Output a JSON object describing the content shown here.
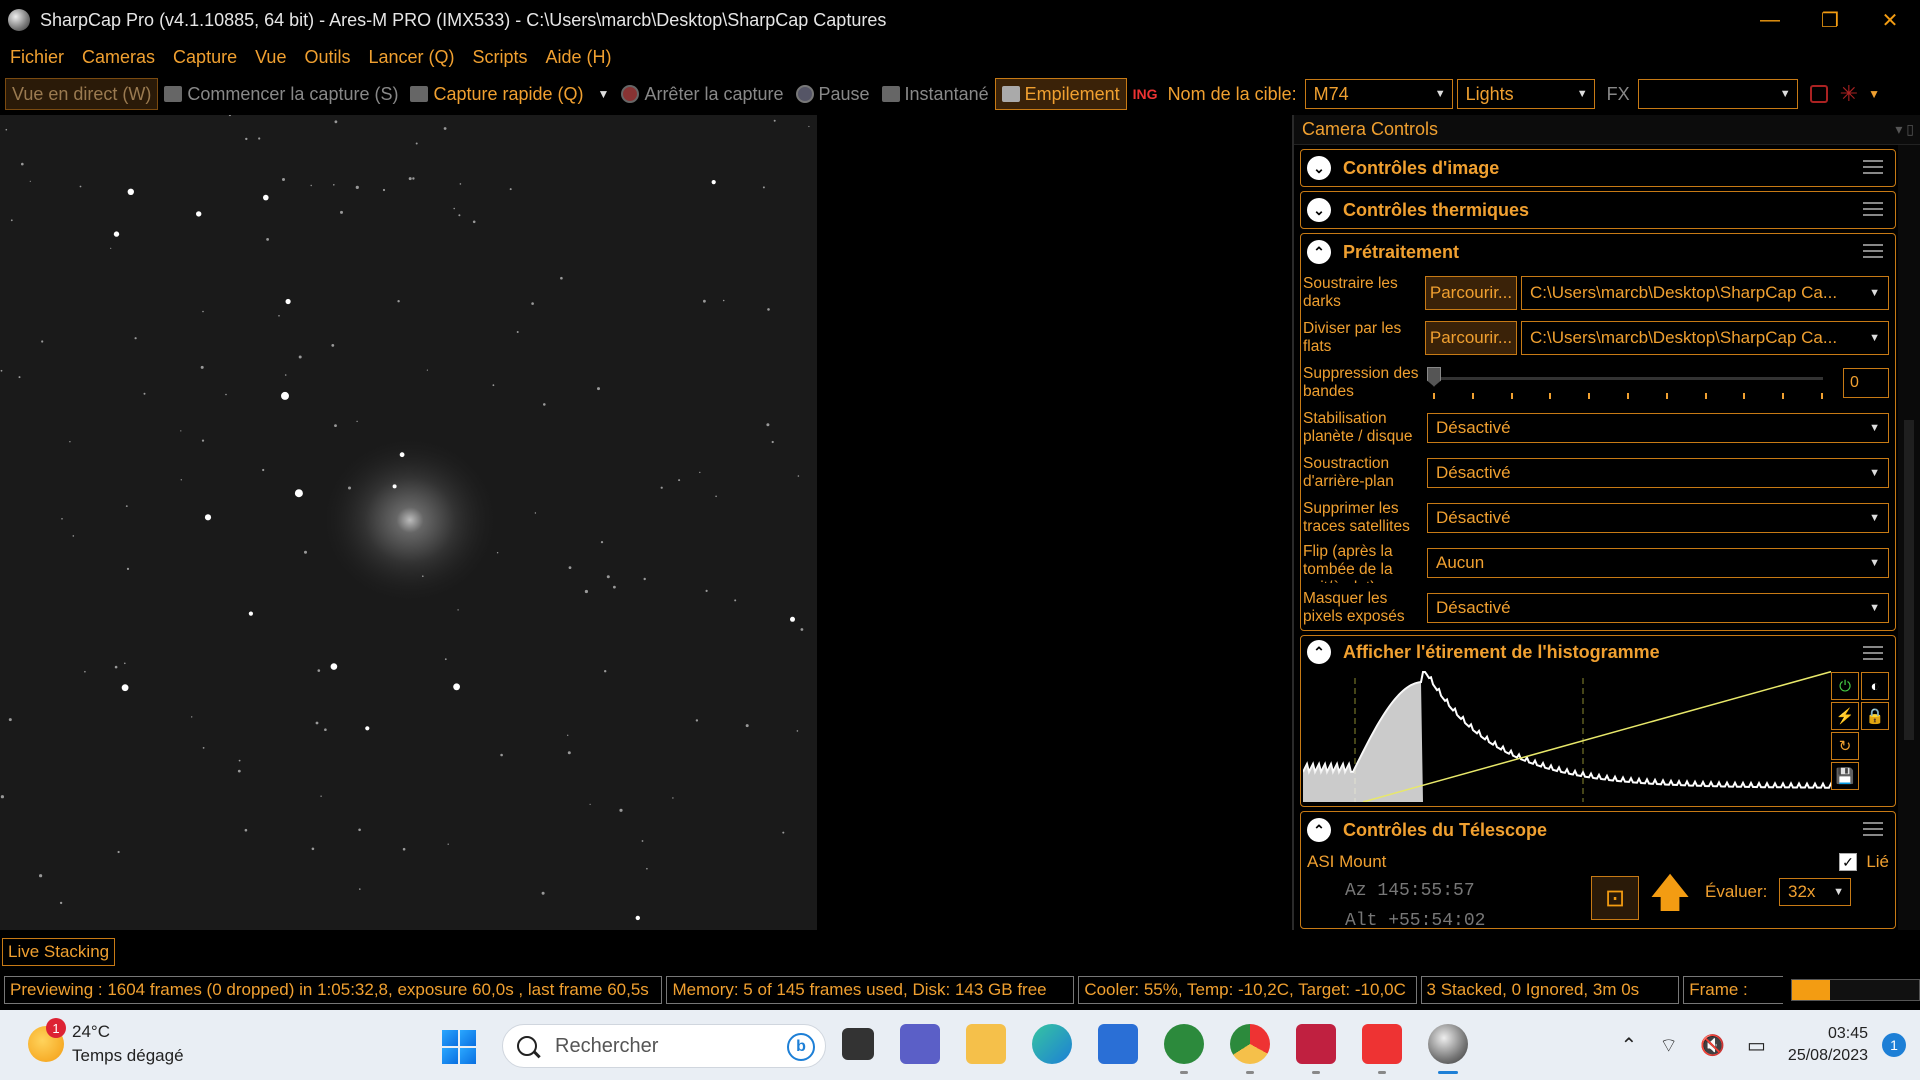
{
  "window": {
    "title": "SharpCap Pro (v4.1.10885, 64 bit) - Ares-M PRO (IMX533) - C:\\Users\\marcb\\Desktop\\SharpCap Captures",
    "controls": [
      "—",
      "❐",
      "✕"
    ]
  },
  "menu": [
    "Fichier",
    "Cameras",
    "Capture",
    "Vue",
    "Outils",
    "Lancer (Q)",
    "Scripts",
    "Aide (H)"
  ],
  "toolbar": {
    "live_view": "Vue en direct (W)",
    "start_capture": "Commencer la capture (S)",
    "quick_capture": "Capture rapide (Q)",
    "stop_capture": "Arrêter la capture",
    "pause": "Pause",
    "snapshot": "Instantané",
    "stacking": "Empilement",
    "target_label": "Nom de la cible:",
    "target_value": "M74",
    "frame_type": "Lights",
    "fx_label": "FX",
    "fx_value": ""
  },
  "panel": {
    "title": "Camera Controls",
    "sections": {
      "image_controls": "Contrôles d'image",
      "thermal": "Contrôles thermiques",
      "preprocessing": "Prétraitement",
      "histogram": "Afficher l'étirement de l'histogramme",
      "telescope": "Contrôles du Télescope"
    },
    "preprocessing": {
      "darks_label": "Soustraire les darks",
      "darks_browse": "Parcourir...",
      "darks_path": "C:\\Users\\marcb\\Desktop\\SharpCap Ca...",
      "flats_label": "Diviser par les flats",
      "flats_browse": "Parcourir...",
      "flats_path": "C:\\Users\\marcb\\Desktop\\SharpCap Ca...",
      "banding_label": "Suppression des bandes",
      "banding_value": "0",
      "stabilization_label": "Stabilisation planète / disque",
      "stabilization_value": "Désactivé",
      "background_label": "Soustraction d'arrière-plan",
      "background_value": "Désactivé",
      "satellite_label": "Supprimer les traces satellites",
      "satellite_value": "Désactivé",
      "flip_label": "Flip (après la tombée de la nuit/à plat)",
      "flip_value": "Aucun",
      "mask_label": "Masquer les pixels exposés",
      "mask_value": "Désactivé"
    },
    "telescope": {
      "mount": "ASI Mount",
      "linked_label": "Lié",
      "linked": true,
      "az": "Az   145:55:57",
      "alt": "Alt  +55:54:02",
      "evaluate_label": "Évaluer:",
      "evaluate_value": "32x"
    }
  },
  "live_stacking_tab": "Live Stacking",
  "status": {
    "preview": "Previewing : 1604 frames (0 dropped) in 1:05:32,8, exposure 60,0s , last frame 60,5s",
    "memory": "Memory: 5 of 145 frames used, Disk: 143 GB free",
    "cooler": "Cooler: 55%, Temp: -10,2C, Target: -10,0C",
    "stacked": "3 Stacked, 0 Ignored, 3m 0s",
    "frame_label": "Frame :",
    "frame_progress": 0.3
  },
  "taskbar": {
    "temperature": "24°C",
    "weather": "Temps dégagé",
    "weather_badge": "1",
    "search_placeholder": "Rechercher",
    "time": "03:45",
    "date": "25/08/2023",
    "notifications": "1"
  },
  "colors": {
    "accent": "#f0a030",
    "border": "#c77a15",
    "histogram_curve": "#e8e86a"
  }
}
